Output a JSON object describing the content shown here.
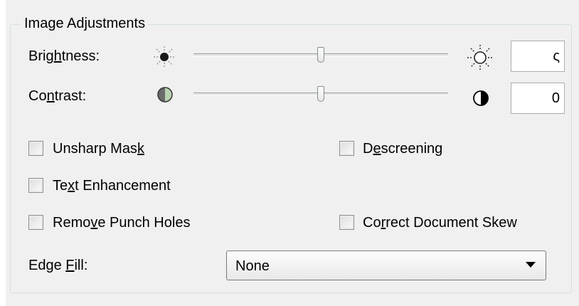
{
  "group": {
    "title": "Image Adjustments"
  },
  "brightness": {
    "label_pre": "Brig",
    "label_key": "h",
    "label_post": "tness:",
    "value": "ς",
    "slider_level": 0.5
  },
  "contrast": {
    "label_pre": "Co",
    "label_key": "n",
    "label_post": "trast:",
    "value": "0",
    "slider_level": 0.5
  },
  "checkboxes": {
    "unsharp": {
      "pre": "Unsharp Mas",
      "key": "k",
      "post": "",
      "checked": false
    },
    "descreening": {
      "pre": "D",
      "key": "e",
      "post": "screening",
      "checked": false
    },
    "text_enh": {
      "pre": "Te",
      "key": "x",
      "post": "t Enhancement",
      "checked": false
    },
    "punch": {
      "pre": "Remo",
      "key": "v",
      "post": "e Punch Holes",
      "checked": false
    },
    "skew": {
      "pre": "Co",
      "key": "r",
      "post": "rect Document Skew",
      "checked": false
    }
  },
  "edge_fill": {
    "label_pre": "Edge ",
    "label_key": "F",
    "label_post": "ill:",
    "selected": "None"
  },
  "icons": {
    "brightness_low": "sun-dim-icon",
    "brightness_high": "sun-bright-icon",
    "contrast_low": "contrast-low-icon",
    "contrast_high": "contrast-high-icon",
    "dropdown": "chevron-down-icon"
  }
}
